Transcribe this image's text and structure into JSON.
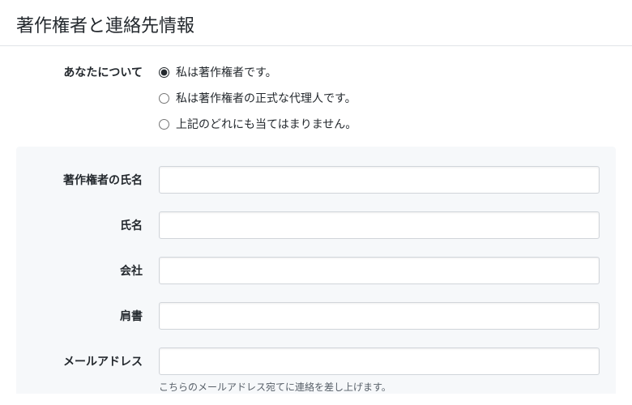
{
  "header": {
    "title": "著作権者と連絡先情報"
  },
  "about": {
    "label": "あなたについて",
    "options": {
      "owner": "私は著作権者です。",
      "agent": "私は著作権者の正式な代理人です。",
      "neither": "上記のどれにも当てはまりません。"
    }
  },
  "form": {
    "copyright_holder_name": {
      "label": "著作権者の氏名",
      "value": ""
    },
    "name": {
      "label": "氏名",
      "value": ""
    },
    "company": {
      "label": "会社",
      "value": ""
    },
    "title_position": {
      "label": "肩書",
      "value": ""
    },
    "email": {
      "label": "メールアドレス",
      "value": "",
      "note": "こちらのメールアドレス宛てに連絡を差し上げます。"
    }
  }
}
